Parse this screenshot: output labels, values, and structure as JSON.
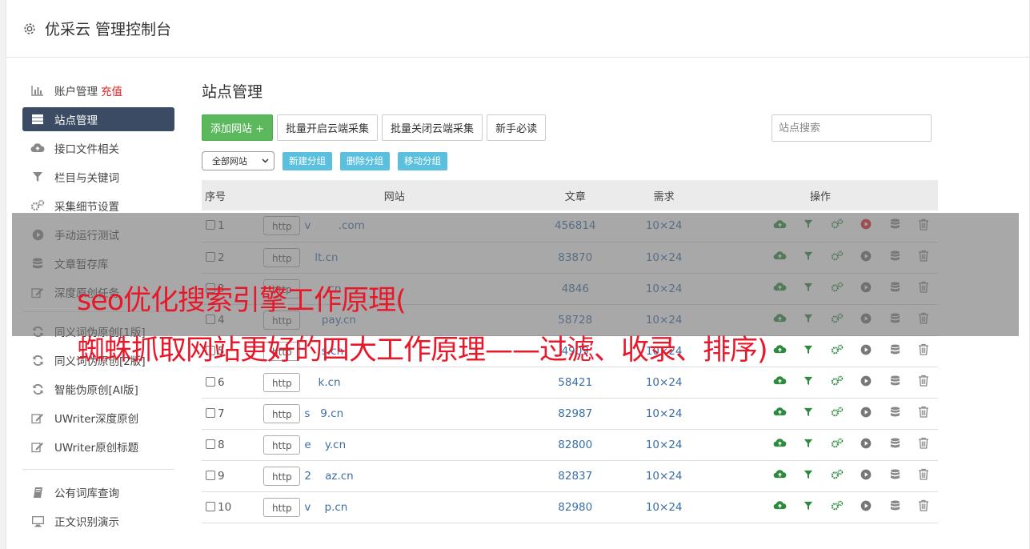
{
  "header": {
    "title": "优采云 管理控制台"
  },
  "sidebar": {
    "items": [
      {
        "label": "账户管理",
        "extra": "充值",
        "icon": "bar-chart-icon"
      },
      {
        "label": "站点管理",
        "icon": "server-icon",
        "active": true
      },
      {
        "label": "接口文件相关",
        "icon": "cloud-upload-icon"
      },
      {
        "label": "栏目与关键词",
        "icon": "filter-icon"
      },
      {
        "label": "采集细节设置",
        "icon": "gears-icon"
      },
      {
        "label": "手动运行测试",
        "icon": "play-circle-icon"
      },
      {
        "label": "文章暂存库",
        "icon": "database-icon"
      },
      {
        "label": "深度原创任务",
        "icon": "edit-icon"
      }
    ],
    "items2": [
      {
        "label": "同义词伪原创[1版]",
        "icon": "refresh-icon"
      },
      {
        "label": "同义词伪原创[2版]",
        "icon": "refresh-icon"
      },
      {
        "label": "智能伪原创[AI版]",
        "icon": "refresh-icon"
      },
      {
        "label": "UWriter深度原创",
        "icon": "edit-icon"
      },
      {
        "label": "UWriter原创标题",
        "icon": "edit-icon"
      }
    ],
    "items3": [
      {
        "label": "公有词库查询",
        "icon": "book-icon"
      },
      {
        "label": "正文识别演示",
        "icon": "monitor-icon"
      }
    ]
  },
  "main": {
    "title": "站点管理",
    "add_button": "添加网站 +",
    "batch_open": "批量开启云端采集",
    "batch_close": "批量关闭云端采集",
    "guide": "新手必读",
    "search_placeholder": "站点搜索",
    "group_select": "全部网站",
    "new_group": "新建分组",
    "delete_group": "删除分组",
    "move_group": "移动分组",
    "columns": {
      "no": "序号",
      "site": "网站",
      "articles": "文章",
      "demand": "需求",
      "ops": "操作"
    },
    "rows": [
      {
        "no": "1",
        "proto": "http",
        "domain": "v        .com",
        "articles": "456814",
        "demand": "10×24"
      },
      {
        "no": "2",
        "proto": "http",
        "domain": "   lt.cn",
        "articles": "83870",
        "demand": "10×24"
      },
      {
        "no": "3",
        "proto": "http",
        "domain": "      .cn",
        "articles": "4846",
        "demand": "10×24"
      },
      {
        "no": "4",
        "proto": "http",
        "domain": "     pay.cn",
        "articles": "58728",
        "demand": "10×24"
      },
      {
        "no": "5",
        "proto": "http",
        "domain": "     s.cn",
        "articles": "4909",
        "demand": "10×24"
      },
      {
        "no": "6",
        "proto": "http",
        "domain": "    k.cn",
        "articles": "58421",
        "demand": "10×24"
      },
      {
        "no": "7",
        "proto": "http",
        "domain": "s   9.cn",
        "articles": "82987",
        "demand": "10×24"
      },
      {
        "no": "8",
        "proto": "http",
        "domain": "e    y.cn",
        "articles": "82800",
        "demand": "10×24"
      },
      {
        "no": "9",
        "proto": "http",
        "domain": "2    az.cn",
        "articles": "82837",
        "demand": "10×24"
      },
      {
        "no": "10",
        "proto": "http",
        "domain": "v    p.cn",
        "articles": "82980",
        "demand": "10×24"
      }
    ]
  },
  "overlay": {
    "line1": "seo优化搜索引擎工作原理(",
    "line2": "蜘蛛抓取网站更好的四大工作原理——过滤、收录、排序)"
  },
  "colors": {
    "accent_green": "#5cb85c",
    "info_blue": "#5bc0de",
    "sidebar_active": "#3b4b63",
    "overlay_text": "#e8182a",
    "link_blue": "#3a6ea5"
  }
}
